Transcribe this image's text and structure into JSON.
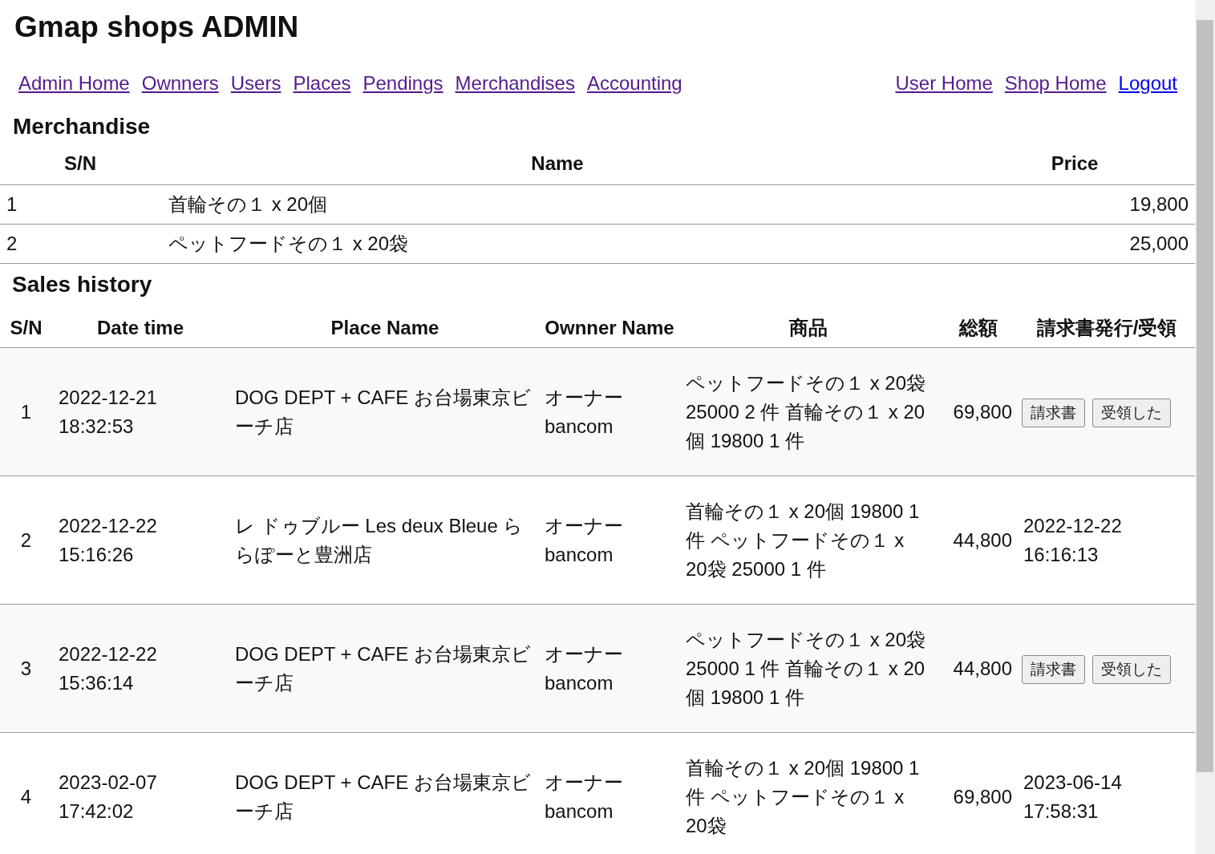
{
  "title": "Gmap shops ADMIN",
  "nav_left": [
    {
      "label": "Admin Home",
      "visited": true
    },
    {
      "label": "Ownners",
      "visited": true
    },
    {
      "label": "Users",
      "visited": true
    },
    {
      "label": "Places",
      "visited": true
    },
    {
      "label": "Pendings",
      "visited": true
    },
    {
      "label": "Merchandises",
      "visited": true
    },
    {
      "label": "Accounting",
      "visited": true
    }
  ],
  "nav_right": [
    {
      "label": "User Home",
      "visited": true
    },
    {
      "label": "Shop Home",
      "visited": true
    },
    {
      "label": "Logout",
      "visited": false
    }
  ],
  "merchandise": {
    "heading": "Merchandise",
    "columns": [
      "S/N",
      "Name",
      "Price"
    ],
    "rows": [
      [
        "1",
        "首輪その１ x 20個",
        "19,800"
      ],
      [
        "2",
        "ペットフードその１ x 20袋",
        "25,000"
      ]
    ]
  },
  "sales": {
    "heading": "Sales history",
    "columns": [
      "S/N",
      "Date time",
      "Place Name",
      "Ownner Name",
      "商品",
      "総額",
      "請求書発行/受領"
    ],
    "rows": [
      {
        "sn": "1",
        "datetime": "2022-12-21 18:32:53",
        "place": "DOG DEPT + CAFE お台場東京ビーチ店",
        "owner": "オーナー bancom",
        "items": "ペットフードその１ x 20袋 25000 2 件 首輪その１ x 20個 19800 1 件",
        "total": "69,800",
        "status": {
          "kind": "buttons",
          "buttons": [
            "請求書",
            "受領した"
          ]
        }
      },
      {
        "sn": "2",
        "datetime": "2022-12-22 15:16:26",
        "place": "レ ドゥブルー Les deux Bleue ららぽーと豊洲店",
        "owner": "オーナー bancom",
        "items": "首輪その１ x 20個 19800 1 件 ペットフードその１ x 20袋 25000 1 件",
        "total": "44,800",
        "status": {
          "kind": "date",
          "text": "2022-12-22 16:16:13"
        }
      },
      {
        "sn": "3",
        "datetime": "2022-12-22 15:36:14",
        "place": "DOG DEPT + CAFE お台場東京ビーチ店",
        "owner": "オーナー bancom",
        "items": "ペットフードその１ x 20袋 25000 1 件 首輪その１ x 20個 19800 1 件",
        "total": "44,800",
        "status": {
          "kind": "buttons",
          "buttons": [
            "請求書",
            "受領した"
          ]
        }
      },
      {
        "sn": "4",
        "datetime": "2023-02-07 17:42:02",
        "place": "DOG DEPT + CAFE お台場東京ビーチ店",
        "owner": "オーナー bancom",
        "items": "首輪その１ x 20個 19800 1 件 ペットフードその１ x 20袋",
        "total": "69,800",
        "status": {
          "kind": "date",
          "text": "2023-06-14 17:58:31"
        }
      }
    ]
  }
}
